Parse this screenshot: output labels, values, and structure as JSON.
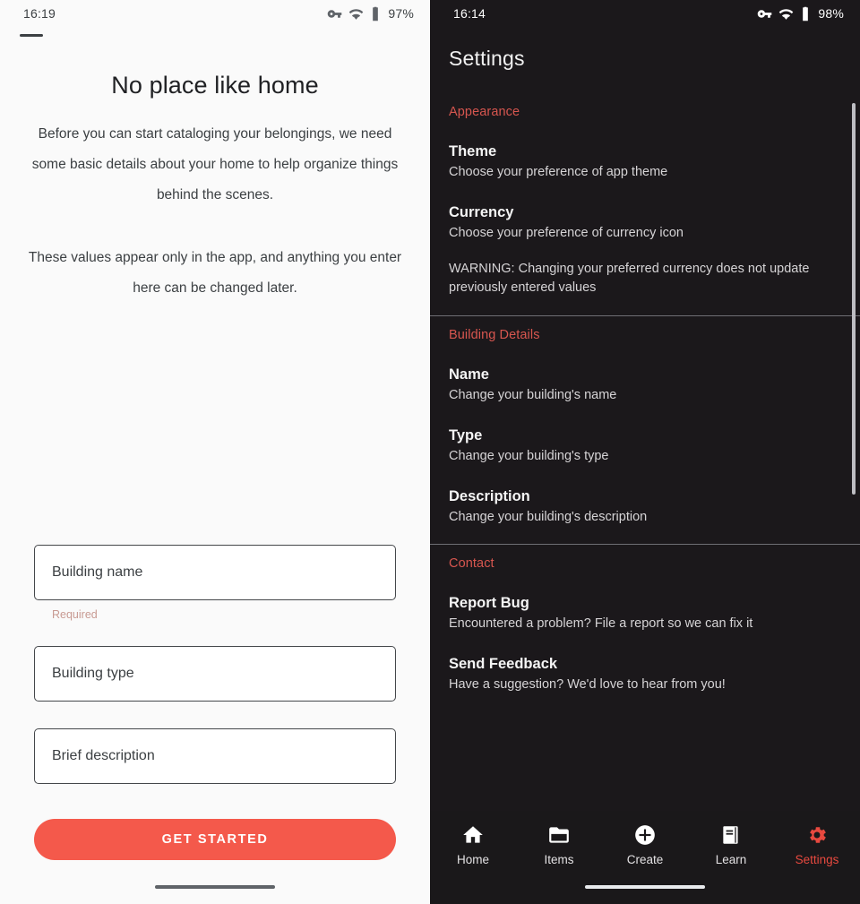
{
  "colors": {
    "accent": "#f4594b",
    "section_header": "#d7564f",
    "active_nav": "#e8493f",
    "required_hint": "#c89a92",
    "dark_bg": "#1b181b",
    "light_bg": "#fafafa"
  },
  "left_screen": {
    "statusbar": {
      "time": "16:19",
      "battery": "97%",
      "icons": [
        "vpn-key-icon",
        "wifi-icon",
        "battery-icon"
      ]
    },
    "title": "No place like home",
    "paragraph_1": "Before you can start cataloging your belongings, we need some basic details about your home to help organize things behind the scenes.",
    "paragraph_2": "These values appear only in the app, and anything you enter here can be changed later.",
    "form": {
      "building_name": {
        "placeholder": "Building name",
        "value": "",
        "hint": "Required"
      },
      "building_type": {
        "placeholder": "Building type",
        "value": ""
      },
      "description": {
        "placeholder": "Brief description",
        "value": ""
      },
      "submit_label": "GET STARTED"
    }
  },
  "right_screen": {
    "statusbar": {
      "time": "16:14",
      "battery": "98%",
      "icons": [
        "vpn-key-icon",
        "wifi-icon",
        "battery-icon"
      ]
    },
    "title": "Settings",
    "sections": [
      {
        "title": "Appearance",
        "rows": [
          {
            "label": "Theme",
            "desc": "Choose your preference of app theme"
          },
          {
            "label": "Currency",
            "desc": "Choose your preference of currency icon"
          }
        ],
        "warning": "WARNING: Changing your preferred currency does not update previously entered values"
      },
      {
        "title": "Building Details",
        "rows": [
          {
            "label": "Name",
            "desc": "Change your building's name"
          },
          {
            "label": "Type",
            "desc": "Change your building's type"
          },
          {
            "label": "Description",
            "desc": "Change your building's description"
          }
        ]
      },
      {
        "title": "Contact",
        "rows": [
          {
            "label": "Report Bug",
            "desc": "Encountered a problem? File a report so we can fix it"
          },
          {
            "label": "Send Feedback",
            "desc": "Have a suggestion? We'd love to hear from you!"
          }
        ]
      }
    ],
    "bottom_nav": {
      "items": [
        {
          "label": "Home",
          "icon": "home-icon",
          "active": false
        },
        {
          "label": "Items",
          "icon": "folder-icon",
          "active": false
        },
        {
          "label": "Create",
          "icon": "plus-circle-icon",
          "active": false
        },
        {
          "label": "Learn",
          "icon": "book-icon",
          "active": false
        },
        {
          "label": "Settings",
          "icon": "gear-icon",
          "active": true
        }
      ]
    }
  }
}
